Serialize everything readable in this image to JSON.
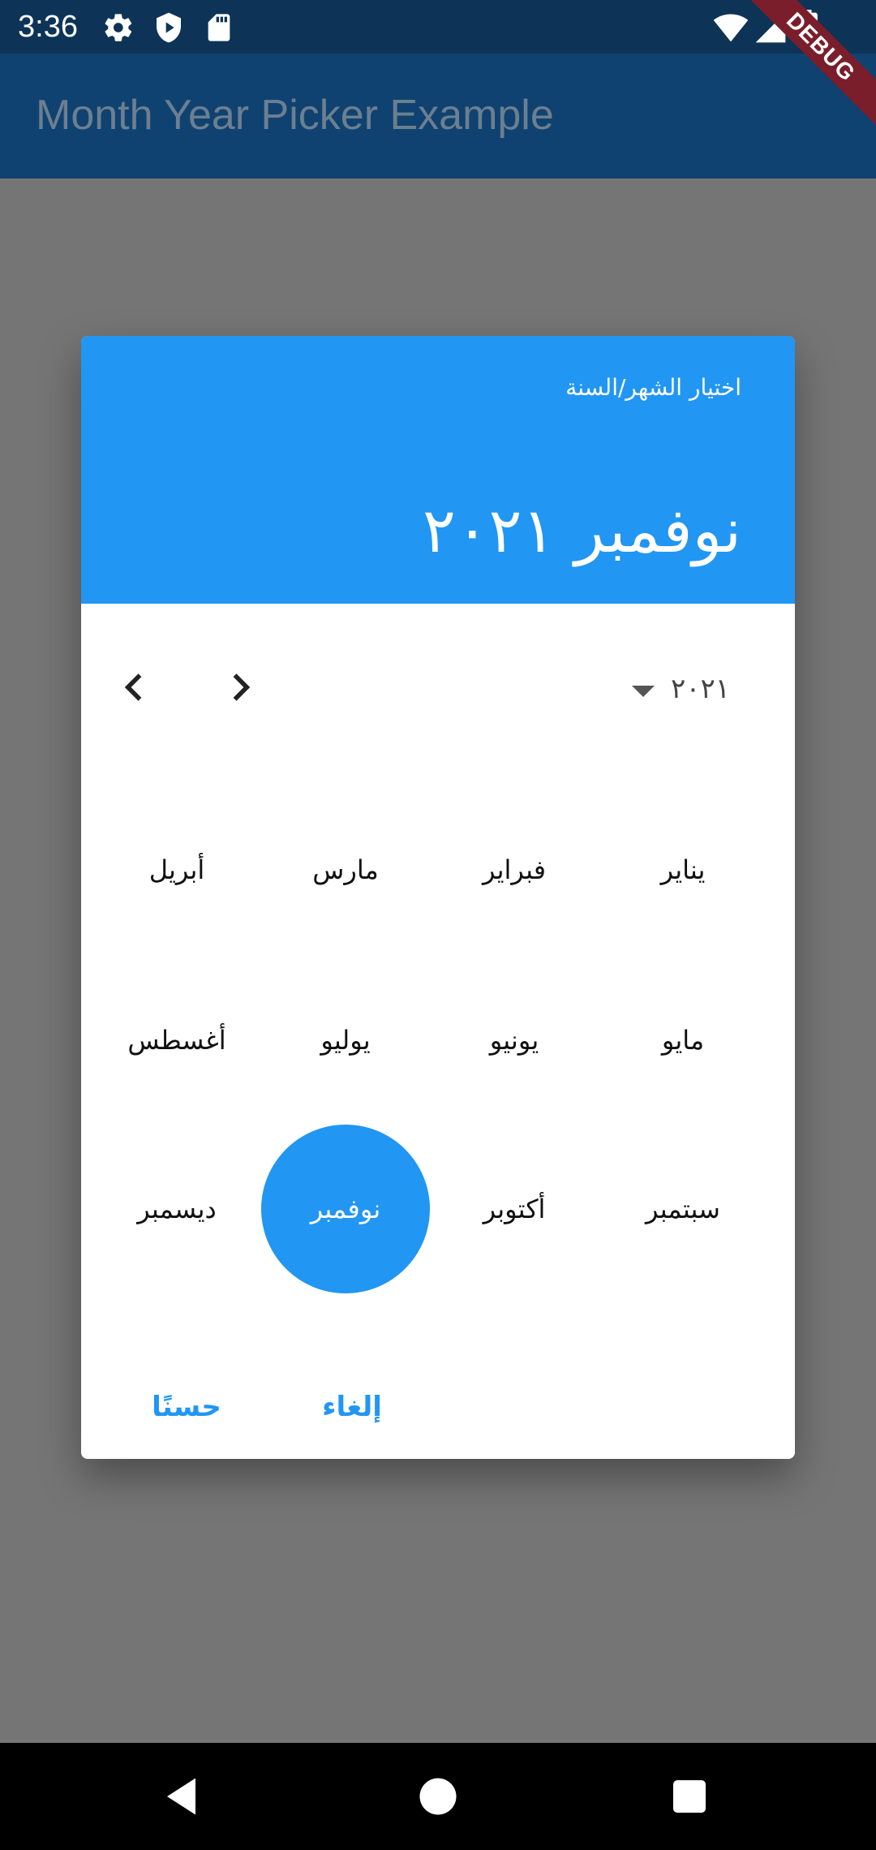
{
  "status_bar": {
    "time": "3:36",
    "left_icons": [
      "settings-icon",
      "play-protect-icon",
      "sd-card-icon"
    ],
    "right_icons": [
      "wifi-icon",
      "signal-icon",
      "battery-icon"
    ]
  },
  "app_bar": {
    "title": "Month Year Picker Example",
    "debug_banner": "DEBUG"
  },
  "dialog": {
    "header": {
      "subtitle": "اختيار الشهر/السنة",
      "selected": "نوفمبر ٢٠٢١"
    },
    "year_dropdown": "٢٠٢١",
    "months": [
      "يناير",
      "فبراير",
      "مارس",
      "أبريل",
      "مايو",
      "يونيو",
      "يوليو",
      "أغسطس",
      "سبتمبر",
      "أكتوبر",
      "نوفمبر",
      "ديسمبر"
    ],
    "selected_month_index": 10,
    "buttons": {
      "cancel": "إلغاء",
      "ok": "حسنًا"
    }
  },
  "colors": {
    "status_bar": "#0d3457",
    "app_bar": "#0f4270",
    "accent": "#2196f3",
    "scrim": "#757575"
  }
}
